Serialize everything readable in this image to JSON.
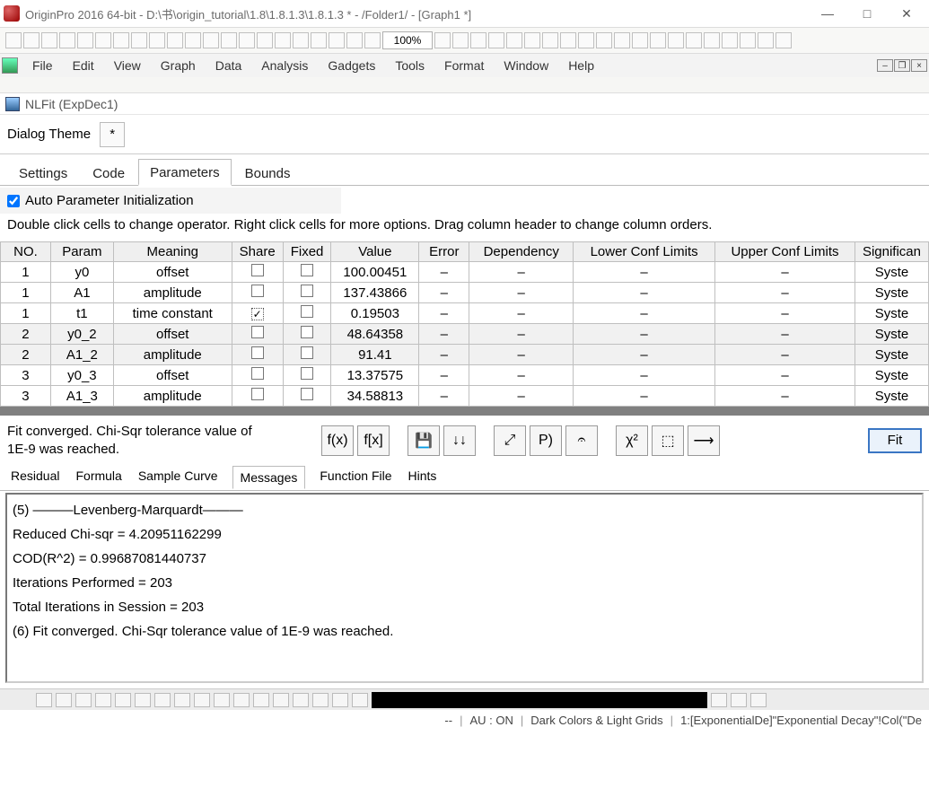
{
  "window": {
    "title": "OriginPro 2016 64-bit - D:\\书\\origin_tutorial\\1.8\\1.8.1.3\\1.8.1.3 * - /Folder1/ - [Graph1 *]",
    "btn_min": "—",
    "btn_max": "□",
    "btn_close": "✕"
  },
  "toolbar": {
    "zoom": "100%"
  },
  "menu": {
    "items": [
      "File",
      "Edit",
      "View",
      "Graph",
      "Data",
      "Analysis",
      "Gadgets",
      "Tools",
      "Format",
      "Window",
      "Help"
    ]
  },
  "dialog": {
    "title": "NLFit (ExpDec1)",
    "theme_label": "Dialog Theme",
    "theme_val": "*",
    "tabs": [
      "Settings",
      "Code",
      "Parameters",
      "Bounds"
    ],
    "active_tab": "Parameters",
    "auto_init_label": "Auto Parameter Initialization",
    "auto_init_checked": true,
    "hint": "Double click cells to change operator. Right click cells for more options. Drag column header to change column orders."
  },
  "columns": {
    "no": "NO.",
    "param": "Param",
    "meaning": "Meaning",
    "share": "Share",
    "fixed": "Fixed",
    "value": "Value",
    "error": "Error",
    "dep": "Dependency",
    "lcl": "Lower Conf Limits",
    "ucl": "Upper Conf Limits",
    "sig": "Significan"
  },
  "rows": [
    {
      "no": "1",
      "param": "y0",
      "meaning": "offset",
      "share": false,
      "fixed": false,
      "value": "100.00451",
      "sig": "Syste",
      "even": false
    },
    {
      "no": "1",
      "param": "A1",
      "meaning": "amplitude",
      "share": false,
      "fixed": false,
      "value": "137.43866",
      "sig": "Syste",
      "even": false
    },
    {
      "no": "1",
      "param": "t1",
      "meaning": "time constant",
      "share": true,
      "fixed": false,
      "value": "0.19503",
      "sig": "Syste",
      "even": false,
      "share_dotted": true
    },
    {
      "no": "2",
      "param": "y0_2",
      "meaning": "offset",
      "share": false,
      "fixed": false,
      "value": "48.64358",
      "sig": "Syste",
      "even": true
    },
    {
      "no": "2",
      "param": "A1_2",
      "meaning": "amplitude",
      "share": false,
      "fixed": false,
      "value": "91.41",
      "sig": "Syste",
      "even": true
    },
    {
      "no": "3",
      "param": "y0_3",
      "meaning": "offset",
      "share": false,
      "fixed": false,
      "value": "13.37575",
      "sig": "Syste",
      "even": false
    },
    {
      "no": "3",
      "param": "A1_3",
      "meaning": "amplitude",
      "share": false,
      "fixed": false,
      "value": "34.58813",
      "sig": "Syste",
      "even": false
    }
  ],
  "dash": "–",
  "status_text_line1": "Fit converged. Chi-Sqr tolerance value of",
  "status_text_line2": "1E-9 was reached.",
  "iconbtns": [
    "f(x)",
    "f[x]",
    "💾",
    "↓↓",
    "⤢",
    "P)",
    "𝄐",
    "χ²",
    "⬚",
    "⟶"
  ],
  "fit_label": "Fit",
  "lower_tabs": [
    "Residual",
    "Formula",
    "Sample Curve",
    "Messages",
    "Function File",
    "Hints"
  ],
  "lower_active": "Messages",
  "messages": [
    "(5) ———Levenberg-Marquardt———",
    "Reduced Chi-sqr = 4.20951162299",
    "COD(R^2) = 0.99687081440737",
    "Iterations Performed = 203",
    "Total Iterations in Session = 203",
    "(6) Fit converged. Chi-Sqr tolerance value of 1E-9 was reached."
  ],
  "statusbar": {
    "left": "--",
    "au": "AU : ON",
    "theme": "Dark Colors & Light Grids",
    "ds": "1:[ExponentialDe]\"Exponential Decay\"!Col(\"De"
  }
}
